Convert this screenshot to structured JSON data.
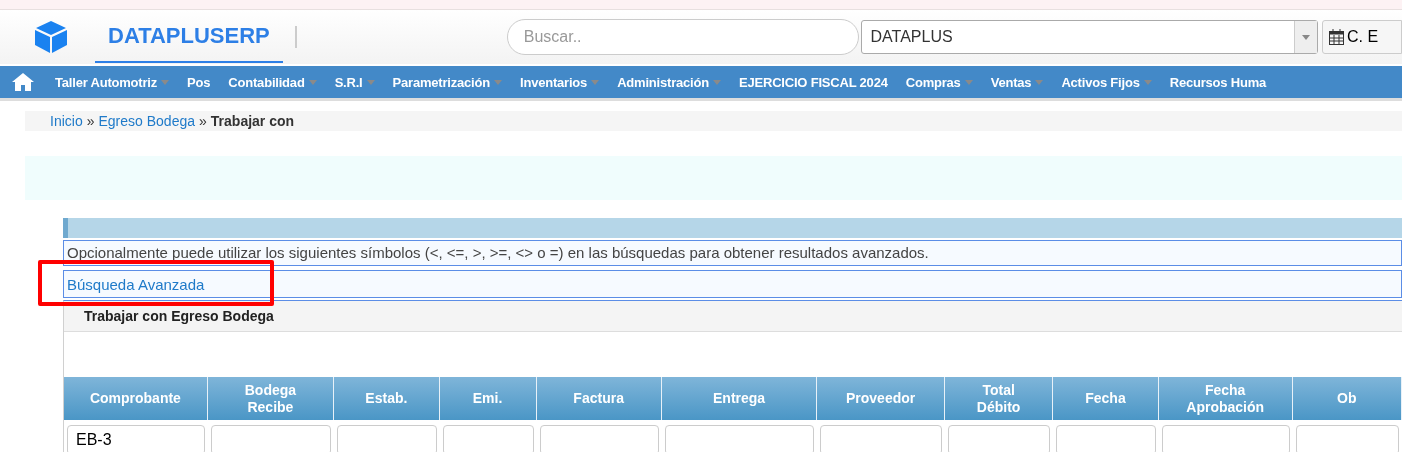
{
  "brand": {
    "name": "DATAPLUSERP"
  },
  "search": {
    "placeholder": "Buscar.."
  },
  "company_select": {
    "value": "DATAPLUS"
  },
  "calendar_button": {
    "label": "C. E"
  },
  "menu": [
    {
      "label": "Taller Automotriz",
      "caret": true
    },
    {
      "label": "Pos",
      "caret": false
    },
    {
      "label": "Contabilidad",
      "caret": true
    },
    {
      "label": "S.R.I",
      "caret": true
    },
    {
      "label": "Parametrización",
      "caret": true
    },
    {
      "label": "Inventarios",
      "caret": true
    },
    {
      "label": "Administración",
      "caret": true
    },
    {
      "label": "EJERCICIO FISCAL 2024",
      "caret": false
    },
    {
      "label": "Compras",
      "caret": true
    },
    {
      "label": "Ventas",
      "caret": true
    },
    {
      "label": "Activos Fijos",
      "caret": true
    },
    {
      "label": "Recursos Huma",
      "caret": false
    }
  ],
  "breadcrumb": [
    {
      "label": "Inicio",
      "link": true
    },
    {
      "label": "Egreso Bodega",
      "link": true
    },
    {
      "label": "Trabajar con",
      "link": false
    }
  ],
  "breadcrumb_separator": "»",
  "hint": "Opcionalmente puede utilizar los siguientes símbolos (<, <=, >, >=, <> o =) en las búsquedas para obtener resultados avanzados.",
  "advanced_search": "Búsqueda Avanzada",
  "grid_title": "Trabajar con Egreso Bodega",
  "table": {
    "columns": [
      {
        "label": "Comprobante",
        "filter": "EB-3"
      },
      {
        "label": "Bodega Recibe"
      },
      {
        "label": "Estab."
      },
      {
        "label": "Emi."
      },
      {
        "label": "Factura"
      },
      {
        "label": "Entrega"
      },
      {
        "label": "Proveedor"
      },
      {
        "label": "Total Débito"
      },
      {
        "label": "Fecha"
      },
      {
        "label": "Fecha Aprobación"
      },
      {
        "label": "Ob"
      }
    ]
  }
}
